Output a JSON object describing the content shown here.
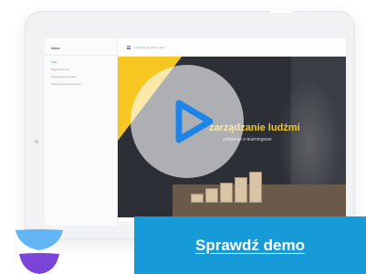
{
  "sidebar": {
    "title": "Inbox",
    "items": [
      {
        "label": "Start",
        "active": true
      },
      {
        "label": "Wprowadzenie",
        "active": false
      },
      {
        "label": "Motywacja zespołów",
        "active": false
      },
      {
        "label": "Materiały końcowe kursu",
        "active": false
      }
    ]
  },
  "topbar": {
    "course_path": "zarzadzanie_ludzmi_kurs"
  },
  "video": {
    "title": "zarządzanie ludźmi",
    "subtitle": "szkolenie e-learningowe",
    "play_icon": "play-icon"
  },
  "cta": {
    "label": "Sprawdź demo"
  },
  "colors": {
    "accent_blue": "#169bd8",
    "play_blue": "#1d84e8",
    "yellow": "#f6c621",
    "logo_blue": "#63b6f5",
    "logo_purple": "#7b43d8"
  }
}
